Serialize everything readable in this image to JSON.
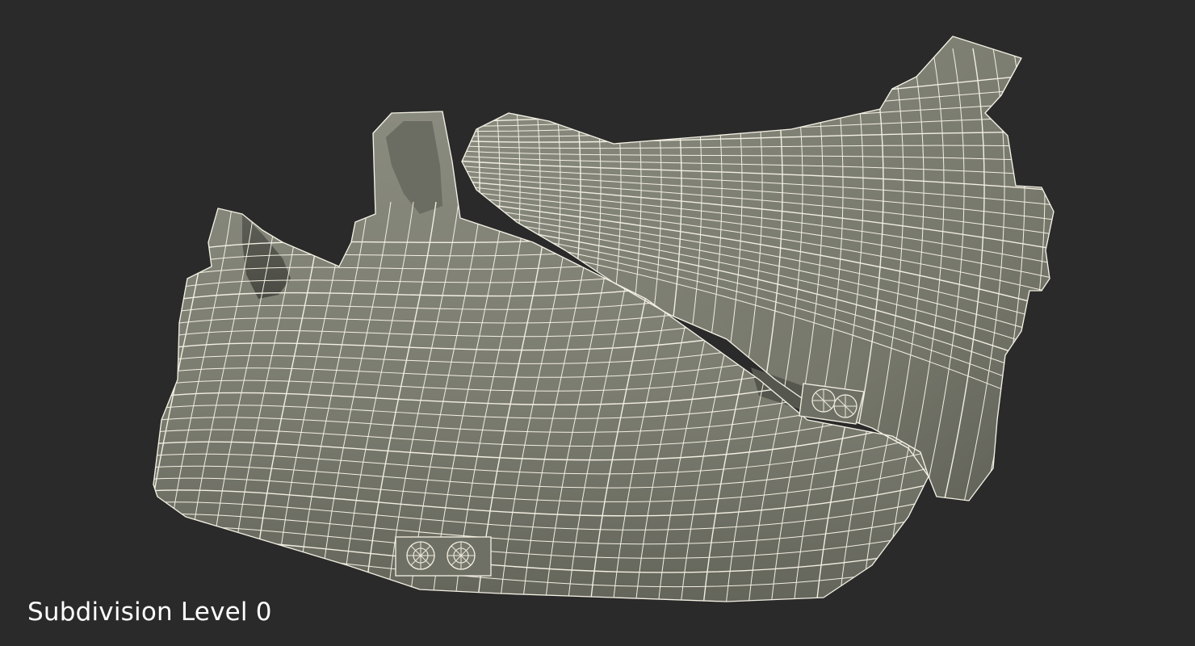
{
  "viewport": {
    "background_color": "#2a2a2a",
    "model_color": "#7c7d71",
    "wire_color": "#f4f1e4"
  },
  "model": {
    "subject": "shoe-sole-wireframe-mesh"
  },
  "caption": {
    "text": "Subdivision Level 0"
  }
}
